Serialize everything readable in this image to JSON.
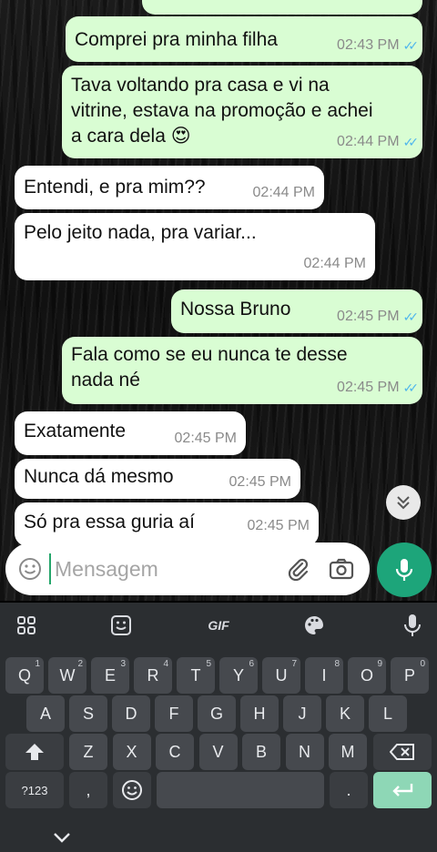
{
  "messages": [
    {
      "text": "Comprei pra minha filha",
      "time": "02:43 PM",
      "dir": "out"
    },
    {
      "text_lines": [
        "Tava voltando pra casa e vi na",
        "vitrine, estava na promoção e achei",
        "a cara dela 😍"
      ],
      "time": "02:44 PM",
      "dir": "out"
    },
    {
      "text": "Entendi, e pra mim??",
      "time": "02:44 PM",
      "dir": "in"
    },
    {
      "text": "Pelo jeito nada, pra variar...",
      "time": "02:44 PM",
      "dir": "in"
    },
    {
      "text": "Nossa Bruno",
      "time": "02:45 PM",
      "dir": "out"
    },
    {
      "text_lines": [
        "Fala como se eu nunca te desse",
        "nada né"
      ],
      "time": "02:45 PM",
      "dir": "out"
    },
    {
      "text": "Exatamente",
      "time": "02:45 PM",
      "dir": "in"
    },
    {
      "text": "Nunca dá mesmo",
      "time": "02:45 PM",
      "dir": "in"
    },
    {
      "text": "Só pra essa guria aí",
      "time": "02:45 PM",
      "dir": "in"
    }
  ],
  "composer": {
    "placeholder": "Mensagem"
  },
  "keyboard": {
    "toolbar": {
      "gif_label": "GIF"
    },
    "row1": [
      {
        "k": "Q",
        "n": "1"
      },
      {
        "k": "W",
        "n": "2"
      },
      {
        "k": "E",
        "n": "3"
      },
      {
        "k": "R",
        "n": "4"
      },
      {
        "k": "T",
        "n": "5"
      },
      {
        "k": "Y",
        "n": "6"
      },
      {
        "k": "U",
        "n": "7"
      },
      {
        "k": "I",
        "n": "8"
      },
      {
        "k": "O",
        "n": "9"
      },
      {
        "k": "P",
        "n": "0"
      }
    ],
    "row2": [
      "A",
      "S",
      "D",
      "F",
      "G",
      "H",
      "J",
      "K",
      "L"
    ],
    "row3": [
      "Z",
      "X",
      "C",
      "V",
      "B",
      "N",
      "M"
    ],
    "sym_label": "?123",
    "comma": ",",
    "period": "."
  },
  "colors": {
    "outgoing": "#d9fdd3",
    "incoming": "#ffffff",
    "accent": "#1da57a",
    "read_ticks": "#4fb6ec"
  }
}
